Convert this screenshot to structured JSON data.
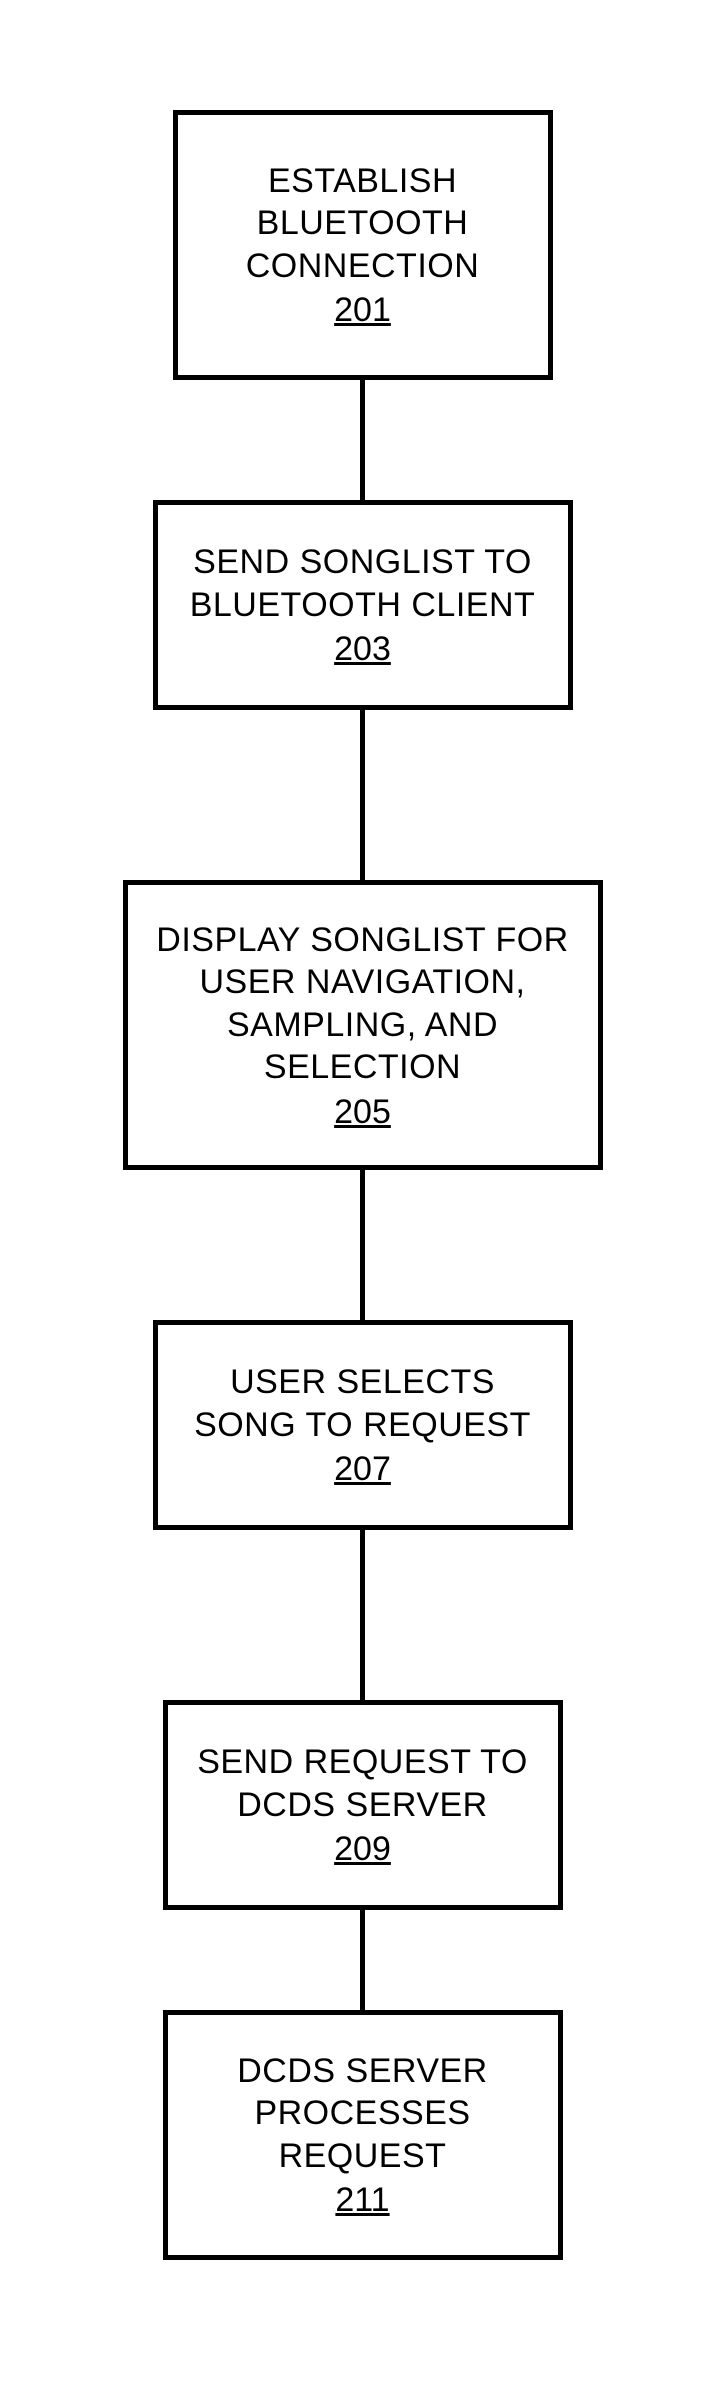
{
  "chart_data": {
    "type": "flowchart",
    "direction": "top-to-bottom",
    "nodes": [
      {
        "id": "201",
        "label": "ESTABLISH\nBLUETOOTH\nCONNECTION",
        "num": "201"
      },
      {
        "id": "203",
        "label": "SEND SONGLIST TO\nBLUETOOTH CLIENT",
        "num": "203"
      },
      {
        "id": "205",
        "label": "DISPLAY SONGLIST FOR\nUSER NAVIGATION,\nSAMPLING, AND SELECTION",
        "num": "205"
      },
      {
        "id": "207",
        "label": "USER SELECTS\nSONG TO REQUEST",
        "num": "207"
      },
      {
        "id": "209",
        "label": "SEND REQUEST TO\nDCDS SERVER",
        "num": "209"
      },
      {
        "id": "211",
        "label": "DCDS SERVER\nPROCESSES\nREQUEST",
        "num": "211"
      }
    ],
    "edges": [
      [
        "201",
        "203"
      ],
      [
        "203",
        "205"
      ],
      [
        "205",
        "207"
      ],
      [
        "207",
        "209"
      ],
      [
        "209",
        "211"
      ]
    ]
  }
}
